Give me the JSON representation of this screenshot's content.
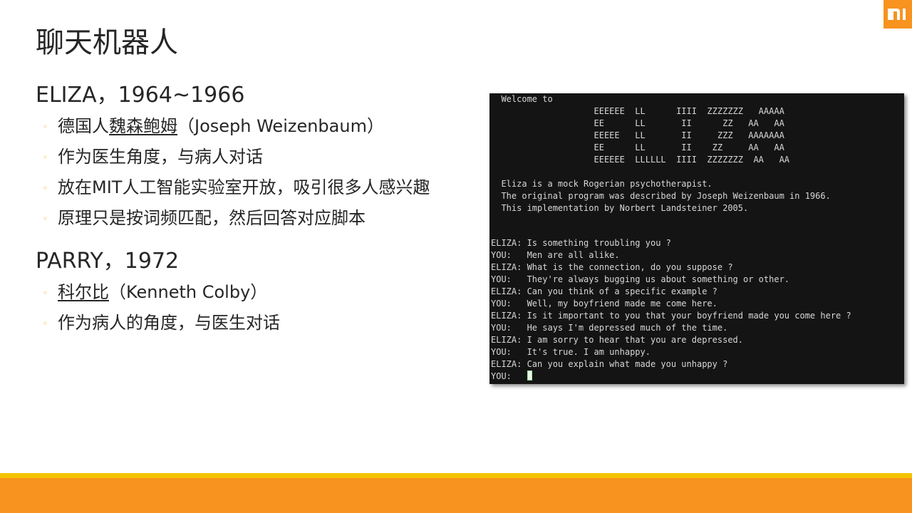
{
  "slide": {
    "title": "聊天机器人",
    "logo_icon": "mi-logo-icon",
    "colors": {
      "accent": "#f7931e",
      "footer_stripe": "#f5c400",
      "bullet": "#f7a21b",
      "terminal_bg": "#141414"
    }
  },
  "bullet_glyph": "◦",
  "sections": [
    {
      "heading": "ELIZA，1964~1966",
      "bullets": [
        {
          "before": "德国人",
          "link": "魏森鲍姆",
          "after": "（Joseph Weizenbaum）"
        },
        {
          "before": "作为医生角度，与病人对话",
          "link": "",
          "after": ""
        },
        {
          "before": "放在MIT人工智能实验室开放，吸引很多人感兴趣",
          "link": "",
          "after": ""
        },
        {
          "before": "原理只是按词频匹配，然后回答对应脚本",
          "link": "",
          "after": ""
        }
      ]
    },
    {
      "heading": "PARRY，1972",
      "bullets": [
        {
          "before": "",
          "link": "科尔比",
          "after": "（Kenneth Colby）"
        },
        {
          "before": "作为病人的角度，与医生对话",
          "link": "",
          "after": ""
        }
      ]
    }
  ],
  "terminal": {
    "lines": [
      "  Welcome to",
      "                    EEEEEE  LL      IIII  ZZZZZZZ   AAAAA",
      "                    EE      LL       II      ZZ   AA   AA",
      "                    EEEEE   LL       II     ZZZ   AAAAAAA",
      "                    EE      LL       II    ZZ     AA   AA",
      "                    EEEEEE  LLLLLL  IIII  ZZZZZZZ  AA   AA",
      "",
      "  Eliza is a mock Rogerian psychotherapist.",
      "  The original program was described by Joseph Weizenbaum in 1966.",
      "  This implementation by Norbert Landsteiner 2005.",
      "",
      "",
      "ELIZA: Is something troubling you ?",
      "YOU:   Men are all alike.",
      "ELIZA: What is the connection, do you suppose ?",
      "YOU:   They're always bugging us about something or other.",
      "ELIZA: Can you think of a specific example ?",
      "YOU:   Well, my boyfriend made me come here.",
      "ELIZA: Is it important to you that your boyfriend made you come here ?",
      "YOU:   He says I'm depressed much of the time.",
      "ELIZA: I am sorry to hear that you are depressed.",
      "YOU:   It's true. I am unhappy.",
      "ELIZA: Can you explain what made you unhappy ?"
    ],
    "prompt": "YOU:   "
  }
}
